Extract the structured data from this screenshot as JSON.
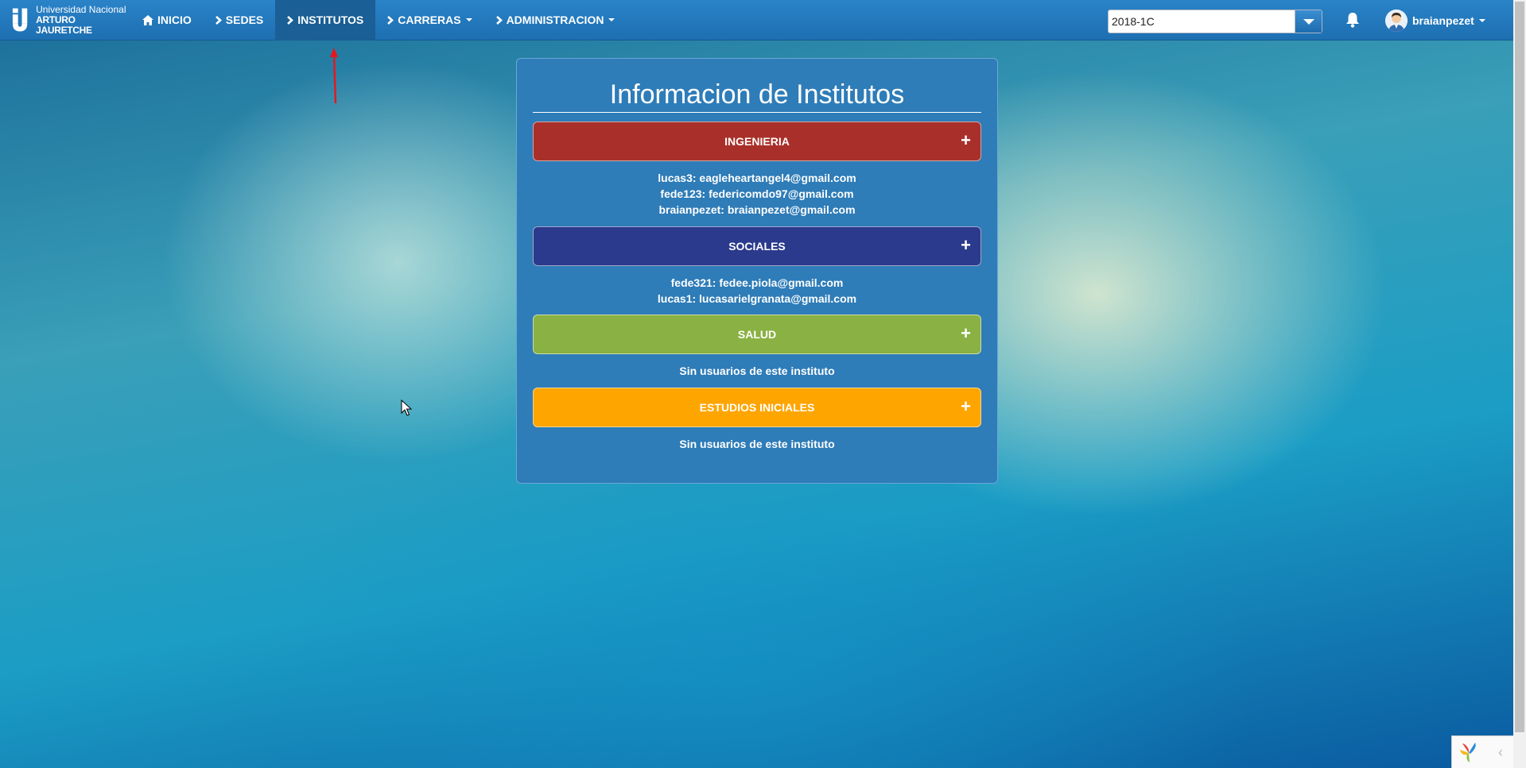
{
  "logo": {
    "line1": "Universidad Nacional",
    "line2": "ARTURO JAURETCHE"
  },
  "nav": {
    "items": [
      {
        "label": "INICIO",
        "icon": "home-icon"
      },
      {
        "label": "SEDES",
        "icon": "chevron-right-icon"
      },
      {
        "label": "INSTITUTOS",
        "icon": "chevron-right-icon",
        "active": true
      },
      {
        "label": "CARRERAS",
        "icon": "chevron-right-icon",
        "dropdown": true
      },
      {
        "label": "ADMINISTRACION",
        "icon": "chevron-right-icon",
        "dropdown": true
      }
    ]
  },
  "period_select": {
    "value": "2018-1C"
  },
  "user": {
    "name": "braianpezet"
  },
  "panel": {
    "title": "Informacion de Institutos",
    "institutes": [
      {
        "name": "INGENIERIA",
        "color": "#a9302a",
        "users": [
          "lucas3: eagleheartangel4@gmail.com",
          "fede123: federicomdo97@gmail.com",
          "braianpezet: braianpezet@gmail.com"
        ]
      },
      {
        "name": "SOCIALES",
        "color": "#2b3a8c",
        "users": [
          "fede321: fedee.piola@gmail.com",
          "lucas1: lucasarielgranata@gmail.com"
        ]
      },
      {
        "name": "SALUD",
        "color": "#8ab143",
        "empty_text": "Sin usuarios de este instituto"
      },
      {
        "name": "ESTUDIOS INICIALES",
        "color": "#ffa500",
        "empty_text": "Sin usuarios de este instituto"
      }
    ],
    "plus_symbol": "+"
  },
  "colors": {
    "navbar": "#1d6fb1",
    "panel": "#2e7cb8",
    "annotation_arrow": "#e8161b"
  }
}
